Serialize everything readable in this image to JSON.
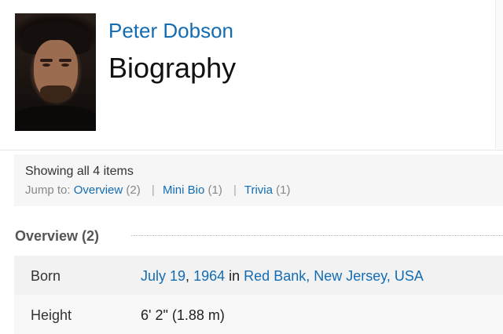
{
  "header": {
    "name": "Peter Dobson",
    "title": "Biography"
  },
  "jump": {
    "showing": "Showing all 4 items",
    "jump_to": "Jump to:",
    "items": [
      {
        "label": "Overview",
        "count": "(2)"
      },
      {
        "label": "Mini Bio",
        "count": "(1)"
      },
      {
        "label": "Trivia",
        "count": "(1)"
      }
    ],
    "separator": "|"
  },
  "overview": {
    "heading": "Overview (2)",
    "rows": [
      {
        "label": "Born",
        "date": "July 19",
        "comma": ",",
        "year": "1964",
        "in": "in",
        "place": "Red Bank, New Jersey, USA"
      },
      {
        "label": "Height",
        "value": "6' 2\" (1.88 m)"
      }
    ]
  },
  "colors": {
    "link": "#136cb2",
    "title_text": "#111111",
    "panel_bg": "#f6f6f6"
  }
}
